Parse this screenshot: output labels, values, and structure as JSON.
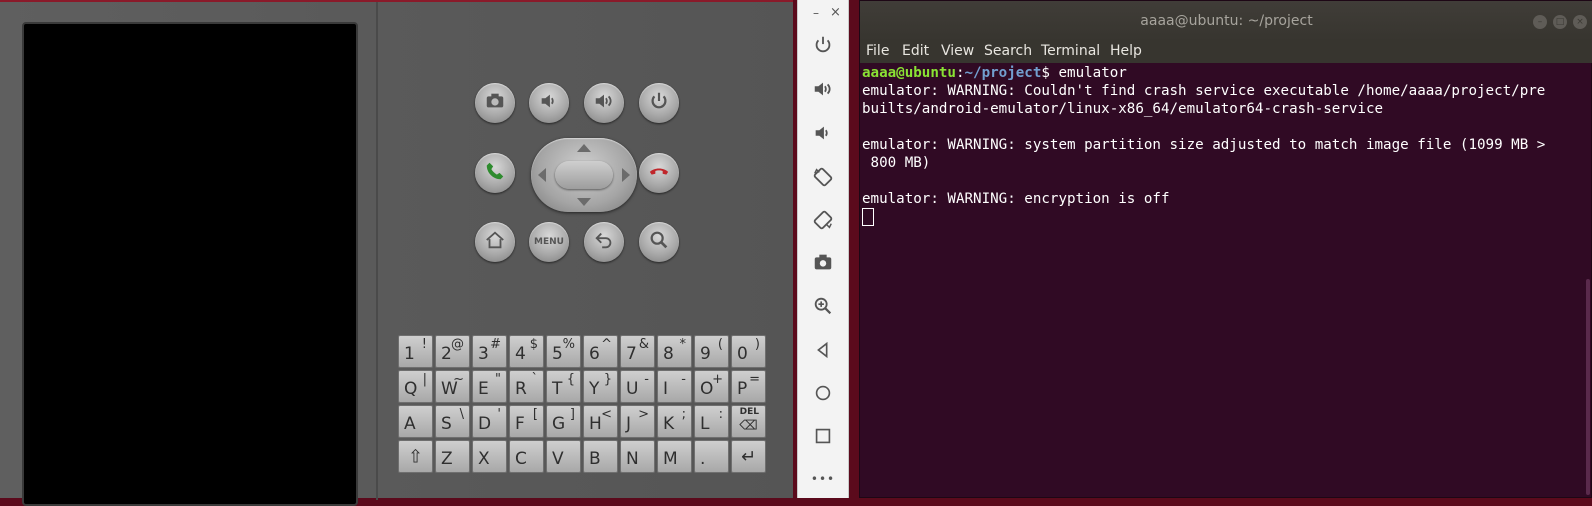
{
  "emulator_skin": {
    "buttons": [
      {
        "icon": "camera-icon"
      },
      {
        "icon": "volume-down-icon"
      },
      {
        "icon": "volume-up-icon"
      },
      {
        "icon": "power-icon"
      },
      {
        "icon": "call-icon",
        "color": "#2e8b2e"
      },
      {
        "icon": "end-call-icon",
        "color": "#c0262b"
      },
      {
        "icon": "home-icon"
      },
      {
        "label": "MENU"
      },
      {
        "icon": "back-icon"
      },
      {
        "icon": "search-icon"
      }
    ],
    "keyboard": {
      "row1": [
        [
          "1",
          "!"
        ],
        [
          "2",
          "@"
        ],
        [
          "3",
          "#"
        ],
        [
          "4",
          "$"
        ],
        [
          "5",
          "%"
        ],
        [
          "6",
          "^"
        ],
        [
          "7",
          "&"
        ],
        [
          "8",
          "*"
        ],
        [
          "9",
          "("
        ],
        [
          "0",
          ")"
        ]
      ],
      "row2": [
        [
          "Q",
          "|"
        ],
        [
          "W",
          "~"
        ],
        [
          "E",
          "\""
        ],
        [
          "R",
          "`"
        ],
        [
          "T",
          "{"
        ],
        [
          "Y",
          "}"
        ],
        [
          "U",
          "-"
        ],
        [
          "I",
          "-"
        ],
        [
          "O",
          "+"
        ],
        [
          "P",
          "="
        ]
      ],
      "row3": [
        [
          "A",
          ""
        ],
        [
          "S",
          "\\"
        ],
        [
          "D",
          "'"
        ],
        [
          "F",
          "["
        ],
        [
          "G",
          "]"
        ],
        [
          "H",
          "<"
        ],
        [
          "J",
          ">"
        ],
        [
          "K",
          ";"
        ],
        [
          "L",
          ":"
        ],
        [
          "DEL",
          ""
        ]
      ],
      "row4": [
        [
          "shift",
          ""
        ],
        [
          "Z",
          ""
        ],
        [
          "X",
          ""
        ],
        [
          "C",
          ""
        ],
        [
          "V",
          ""
        ],
        [
          "B",
          ""
        ],
        [
          "N",
          ""
        ],
        [
          "M",
          ""
        ],
        [
          ".",
          ""
        ],
        [
          "enter",
          ""
        ]
      ]
    }
  },
  "emulator_toolbar": {
    "minimize": "–",
    "close": "×",
    "tools": [
      "power-icon",
      "volume-up-icon",
      "volume-down-icon",
      "rotate-left-icon",
      "rotate-right-icon",
      "screenshot-icon",
      "zoom-icon",
      "back-icon",
      "home-icon",
      "overview-icon",
      "more-icon"
    ],
    "more_label": "•••"
  },
  "terminal": {
    "title": "aaaa@ubuntu: ~/project",
    "menu": [
      "File",
      "Edit",
      "View",
      "Search",
      "Terminal",
      "Help"
    ],
    "prompt_user": "aaaa@ubuntu",
    "prompt_sep": ":",
    "prompt_path": "~/project",
    "prompt_end": "$ ",
    "command": "emulator",
    "output": [
      "emulator: WARNING: Couldn't find crash service executable /home/aaaa/project/pre",
      "builts/android-emulator/linux-x86_64/emulator64-crash-service",
      "",
      "emulator: WARNING: system partition size adjusted to match image file (1099 MB >",
      " 800 MB)",
      "",
      "emulator: WARNING: encryption is off"
    ],
    "colors": {
      "background": "#300a24",
      "user": "#8ae234",
      "path": "#729fcf"
    }
  }
}
